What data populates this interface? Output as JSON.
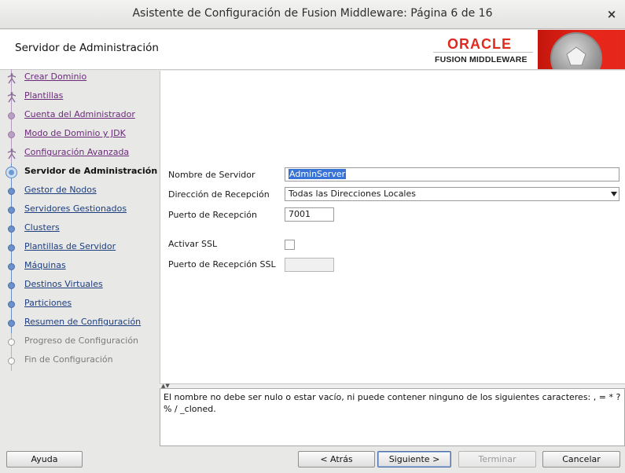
{
  "window": {
    "title": "Asistente de Configuración de Fusion Middleware: Página 6 de 16",
    "close_glyph": "×"
  },
  "header": {
    "page_title": "Servidor de Administración",
    "brand_top": "ORACLE",
    "brand_bottom": "FUSION MIDDLEWARE"
  },
  "nav": {
    "items": [
      {
        "label": "Crear Dominio",
        "state": "visited",
        "icon": "walker-icon"
      },
      {
        "label": "Plantillas",
        "state": "visited",
        "icon": "walker-icon"
      },
      {
        "label": "Cuenta del Administrador",
        "state": "visited",
        "icon": "step-dot-icon"
      },
      {
        "label": "Modo de Dominio y JDK",
        "state": "visited",
        "icon": "step-dot-icon"
      },
      {
        "label": "Configuración Avanzada",
        "state": "visited",
        "icon": "walker-icon"
      },
      {
        "label": "Servidor de Administración",
        "state": "current",
        "icon": "current-step-icon"
      },
      {
        "label": "Gestor de Nodos",
        "state": "pending",
        "icon": "step-dot-icon"
      },
      {
        "label": "Servidores Gestionados",
        "state": "pending",
        "icon": "step-dot-icon"
      },
      {
        "label": "Clusters",
        "state": "pending",
        "icon": "step-dot-icon"
      },
      {
        "label": "Plantillas de Servidor",
        "state": "pending",
        "icon": "step-dot-icon"
      },
      {
        "label": "Máquinas",
        "state": "pending",
        "icon": "step-dot-icon"
      },
      {
        "label": "Destinos Virtuales",
        "state": "pending",
        "icon": "step-dot-icon"
      },
      {
        "label": "Particiones",
        "state": "pending",
        "icon": "step-dot-icon"
      },
      {
        "label": "Resumen de Configuración",
        "state": "pending",
        "icon": "step-dot-icon"
      },
      {
        "label": "Progreso de Configuración",
        "state": "disabled",
        "icon": "step-dot-icon"
      },
      {
        "label": "Fin de Configuración",
        "state": "disabled",
        "icon": "step-dot-icon"
      }
    ]
  },
  "form": {
    "server_name_label": "Nombre de Servidor",
    "server_name_value": "AdminServer",
    "listen_address_label": "Dirección de Recepción",
    "listen_address_value": "Todas las Direcciones Locales",
    "listen_port_label": "Puerto de Recepción",
    "listen_port_value": "7001",
    "ssl_label": "Activar SSL",
    "ssl_enabled": false,
    "ssl_port_label": "Puerto de Recepción SSL",
    "ssl_port_value": ""
  },
  "message": {
    "text": "El nombre no debe ser nulo o estar vacío, ni puede contener ninguno de los siguientes caracteres: , = * ? % / _cloned."
  },
  "footer": {
    "help": "Ayuda",
    "back": "< Atrás",
    "next": "Siguiente >",
    "finish": "Terminar",
    "cancel": "Cancelar"
  },
  "colors": {
    "brand_red": "#e02a20",
    "visited_link": "#6b2a7a",
    "pending_link": "#1c3d7e",
    "selection": "#3874d8"
  }
}
